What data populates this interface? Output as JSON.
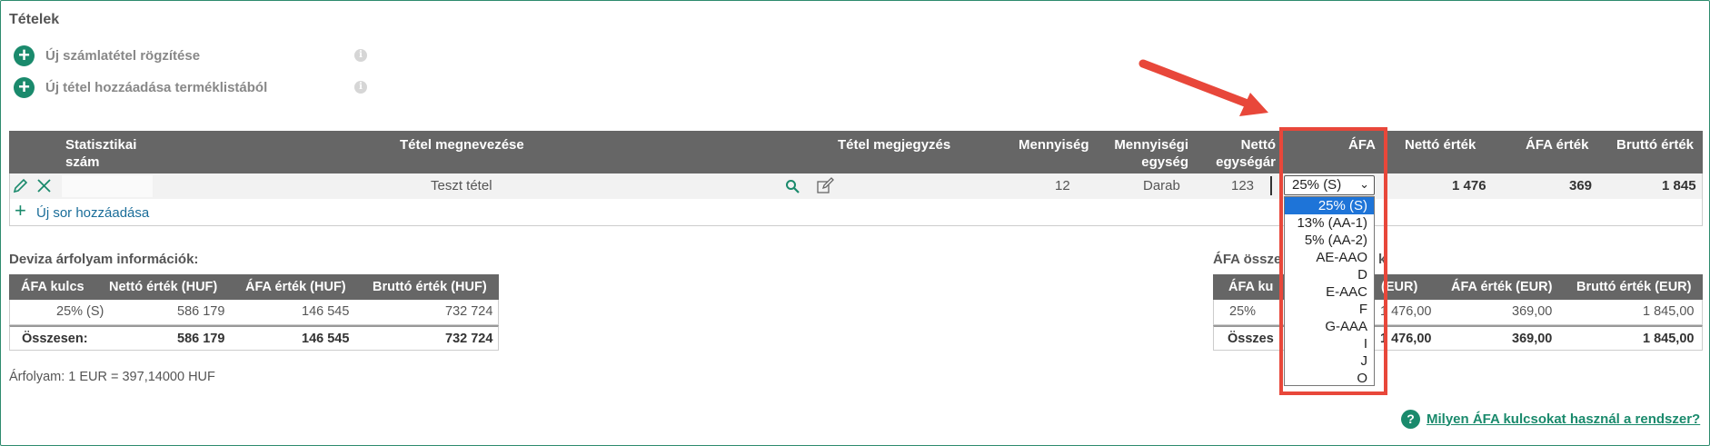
{
  "section": {
    "title": "Tételek"
  },
  "actions": [
    {
      "label": "Új számlatétel rögzítése",
      "info": "i"
    },
    {
      "label": "Új tétel hozzáadása terméklistából",
      "info": "i"
    }
  ],
  "main_table": {
    "headers": {
      "stat1": "Statisztikai",
      "stat2": "szám",
      "name": "Tétel megnevezése",
      "note": "Tétel megjegyzés",
      "qty": "Mennyiség",
      "unit1": "Mennyiségi",
      "unit2": "egység",
      "netprice1": "Nettó",
      "netprice2": "egységár",
      "vat": "ÁFA",
      "net": "Nettó érték",
      "vatval": "ÁFA érték",
      "gross": "Bruttó érték"
    },
    "row": {
      "name": "Teszt tétel",
      "qty": "12",
      "unit": "Darab",
      "unit_price": "123",
      "vat": "25% (S)",
      "net": "1 476",
      "vatval": "369",
      "gross": "1 845"
    },
    "add_row_label": "Új sor hozzáadása"
  },
  "vat_dropdown": {
    "selected": "25% (S)",
    "options": [
      "25% (S)",
      "13% (AA-1)",
      "5% (AA-2)",
      "AE-AAO",
      "D",
      "E-AAC",
      "F",
      "G-AAA",
      "I",
      "J",
      "O"
    ]
  },
  "currency_info": {
    "title": "Deviza árfolyam információk:",
    "headers": [
      "ÁFA kulcs",
      "Nettó érték (HUF)",
      "ÁFA érték (HUF)",
      "Bruttó érték (HUF)"
    ],
    "rows": [
      [
        "25% (S)",
        "586 179",
        "146 545",
        "732 724"
      ]
    ],
    "total": [
      "Összesen:",
      "586 179",
      "146 545",
      "732 724"
    ],
    "rate": "Árfolyam: 1 EUR = 397,14000 HUF"
  },
  "vat_summary": {
    "title_visible": "ÁFA össze",
    "title_tail": "k",
    "headers": [
      "ÁFA ku",
      "(EUR)",
      "ÁFA érték (EUR)",
      "Bruttó érték (EUR)"
    ],
    "rows": [
      [
        "25%",
        "1 476,00",
        "369,00",
        "1 845,00"
      ]
    ],
    "total": [
      "Összes",
      "1 476,00",
      "369,00",
      "1 845,00"
    ]
  },
  "help": {
    "q": "?",
    "label": "Milyen ÁFA kulcsokat használ a rendszer?"
  },
  "colors": {
    "accent": "#1a8a6c",
    "header_bg": "#666666",
    "highlight": "#e8473a",
    "selected": "#1e74d8"
  }
}
